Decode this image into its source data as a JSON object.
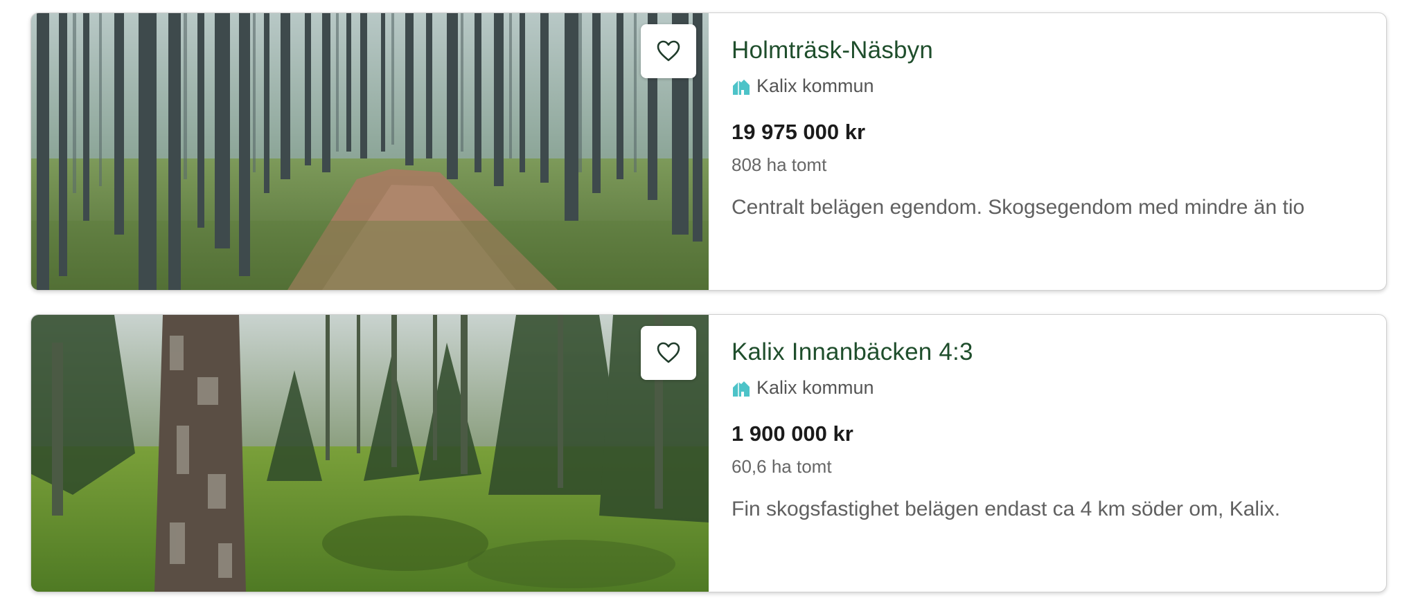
{
  "listings": [
    {
      "title": "Holmträsk-Näsbyn",
      "municipality": "Kalix kommun",
      "price": "19 975 000 kr",
      "area": "808 ha tomt",
      "description": "Centralt belägen egendom. Skogsegendom med mindre än tio",
      "image": "pine-forest-path-photo",
      "favorite_icon": "heart-outline-icon",
      "location_icon": "house-icon"
    },
    {
      "title": "Kalix Innanbäcken 4:3",
      "municipality": "Kalix kommun",
      "price": "1 900 000 kr",
      "area": "60,6 ha tomt",
      "description": "Fin skogsfastighet belägen endast ca 4 km söder om, Kalix.",
      "image": "mossy-forest-photo",
      "favorite_icon": "heart-outline-icon",
      "location_icon": "house-icon"
    }
  ],
  "colors": {
    "title": "#1f4e2c",
    "house_icon": "#4dc3c8",
    "card_border": "#cfcfcf"
  }
}
